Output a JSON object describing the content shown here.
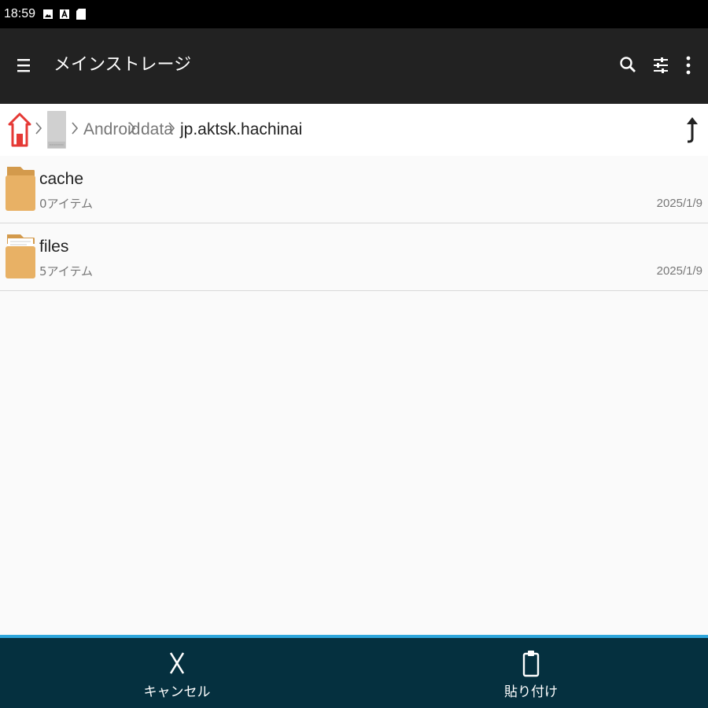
{
  "status_bar": {
    "time": "18:59",
    "icons": [
      "image-icon",
      "a-icon",
      "sd-card-icon"
    ]
  },
  "toolbar": {
    "title": "メインストレージ",
    "icons": [
      "menu-icon",
      "search-icon",
      "filter-icon",
      "more-vert-icon"
    ]
  },
  "breadcrumb": {
    "items": [
      "Android",
      "data",
      "jp.aktsk.hachinai"
    ],
    "icons": [
      "home-icon",
      "storage-icon",
      "up-arrow-icon"
    ]
  },
  "files": [
    {
      "name": "cache",
      "meta": "0アイテム",
      "date": "2025/1/9"
    },
    {
      "name": "files",
      "meta": "5アイテム",
      "date": "2025/1/9"
    }
  ],
  "bottom_bar": {
    "cancel_label": "キャンセル",
    "paste_label": "貼り付け"
  },
  "colors": {
    "toolbar_bg": "#222222",
    "bottom_bar_bg": "#05303f",
    "accent": "#2ea6dc",
    "folder": "#e8b165"
  }
}
